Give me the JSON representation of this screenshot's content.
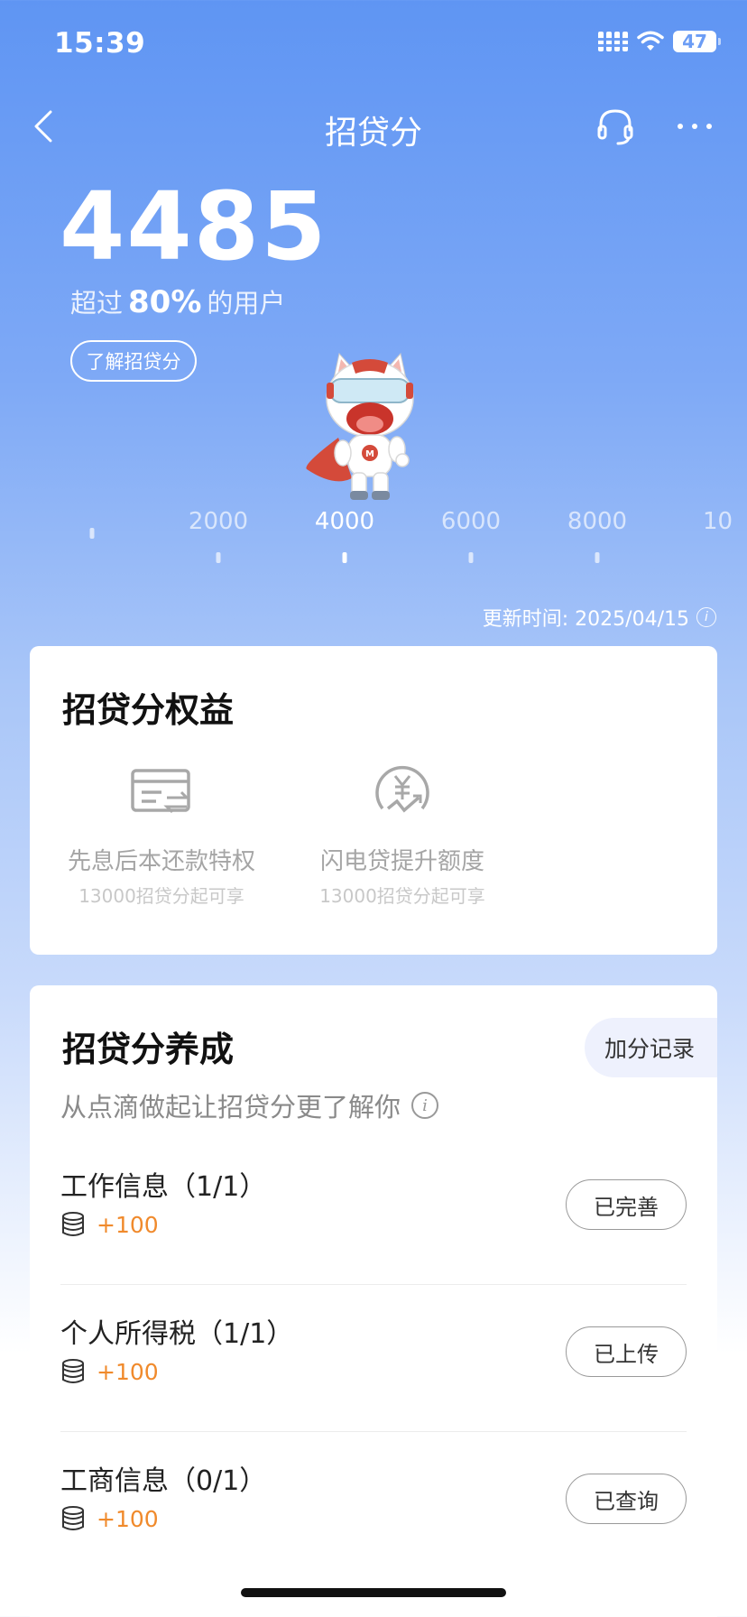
{
  "status_bar": {
    "time": "15:39",
    "battery": "47"
  },
  "nav": {
    "title": "招贷分"
  },
  "score": {
    "value": "4485",
    "exceed_prefix": "超过",
    "exceed_pct": "80%",
    "exceed_suffix": "的用户",
    "learn_more": "了解招贷分"
  },
  "ruler": {
    "labels": [
      "2000",
      "4000",
      "6000",
      "8000",
      "10"
    ]
  },
  "update_time": "更新时间: 2025/04/15",
  "benefits": {
    "title": "招贷分权益",
    "items": [
      {
        "name": "先息后本还款特权",
        "sub": "13000招贷分起可享",
        "icon": "card-transfer-icon"
      },
      {
        "name": "闪电贷提升额度",
        "sub": "13000招贷分起可享",
        "icon": "yuan-up-icon"
      }
    ]
  },
  "cultivate": {
    "title": "招贷分养成",
    "record_button": "加分记录",
    "subtitle": "从点滴做起让招贷分更了解你",
    "tasks": [
      {
        "name": "工作信息（1/1）",
        "points": "+100",
        "button": "已完善"
      },
      {
        "name": "个人所得税（1/1）",
        "points": "+100",
        "button": "已上传"
      },
      {
        "name": "工商信息（0/1）",
        "points": "+100",
        "button": "已查询"
      }
    ]
  },
  "colors": {
    "accent": "#5f95f3",
    "points": "#f08a2c"
  }
}
